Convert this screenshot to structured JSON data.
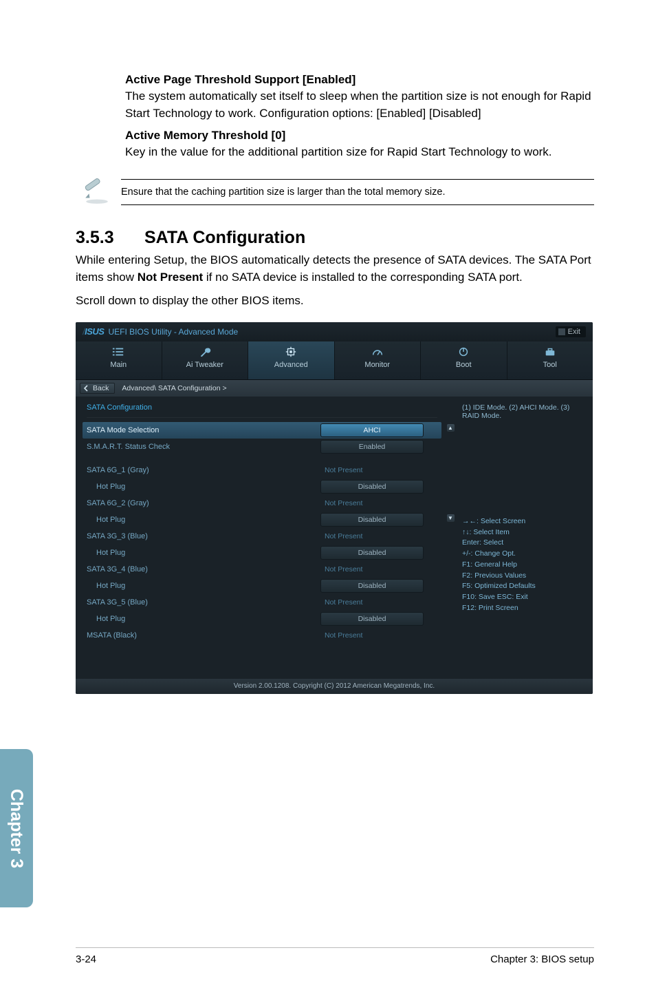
{
  "doc": {
    "sub1_title": "Active Page Threshold Support [Enabled]",
    "sub1_text": "The system automatically set itself to sleep when the partition size is not enough for Rapid Start Technology to work. Configuration options: [Enabled] [Disabled]",
    "sub2_title": "Active Memory Threshold [0]",
    "sub2_text": "Key in the value for the additional partition size for Rapid Start Technology to work.",
    "note": "Ensure that the caching partition size is larger than the total memory size.",
    "sec_num": "3.5.3",
    "sec_title": "SATA Configuration",
    "sec_p1": "While entering Setup, the BIOS automatically detects the presence of SATA devices. The SATA Port items show Not Present if no SATA device is installed to the corresponding SATA port.",
    "sec_p1_pre": "While entering Setup, the BIOS automatically detects the presence of SATA devices. The SATA Port items show ",
    "sec_p1_bold": "Not Present",
    "sec_p1_post": " if no SATA device is installed to the corresponding SATA port.",
    "sec_p2": "Scroll down to display the other BIOS items."
  },
  "bios": {
    "title": "UEFI BIOS Utility - Advanced Mode",
    "exit": "Exit",
    "menu": {
      "main": "Main",
      "ai": "Ai Tweaker",
      "adv": "Advanced",
      "mon": "Monitor",
      "boot": "Boot",
      "tool": "Tool"
    },
    "crumb_back": "Back",
    "crumb_path": "Advanced\\ SATA Configuration  >",
    "head": "SATA Configuration",
    "rows": {
      "mode_label": "SATA Mode Selection",
      "mode_val": "AHCI",
      "smart_label": "S.M.A.R.T. Status Check",
      "smart_val": "Enabled",
      "s1": "SATA 6G_1 (Gray)",
      "s2": "SATA 6G_2 (Gray)",
      "s3": "SATA 3G_3 (Blue)",
      "s4": "SATA 3G_4 (Blue)",
      "s5": "SATA 3G_5 (Blue)",
      "msata": "MSATA (Black)",
      "hot": "Hot Plug",
      "np": "Not Present",
      "dis": "Disabled"
    },
    "right_top": "(1) IDE Mode. (2) AHCI Mode. (3) RAID Mode.",
    "help": {
      "l1": "→←: Select Screen",
      "l2": "↑↓: Select Item",
      "l3": "Enter: Select",
      "l4": "+/-: Change Opt.",
      "l5": "F1: General Help",
      "l6": "F2: Previous Values",
      "l7": "F5: Optimized Defaults",
      "l8": "F10: Save   ESC: Exit",
      "l9": "F12: Print Screen"
    },
    "footer": "Version  2.00.1208.   Copyright  (C)  2012  American  Megatrends,  Inc."
  },
  "side": "Chapter 3",
  "footer_left": "3-24",
  "footer_right": "Chapter 3: BIOS setup"
}
